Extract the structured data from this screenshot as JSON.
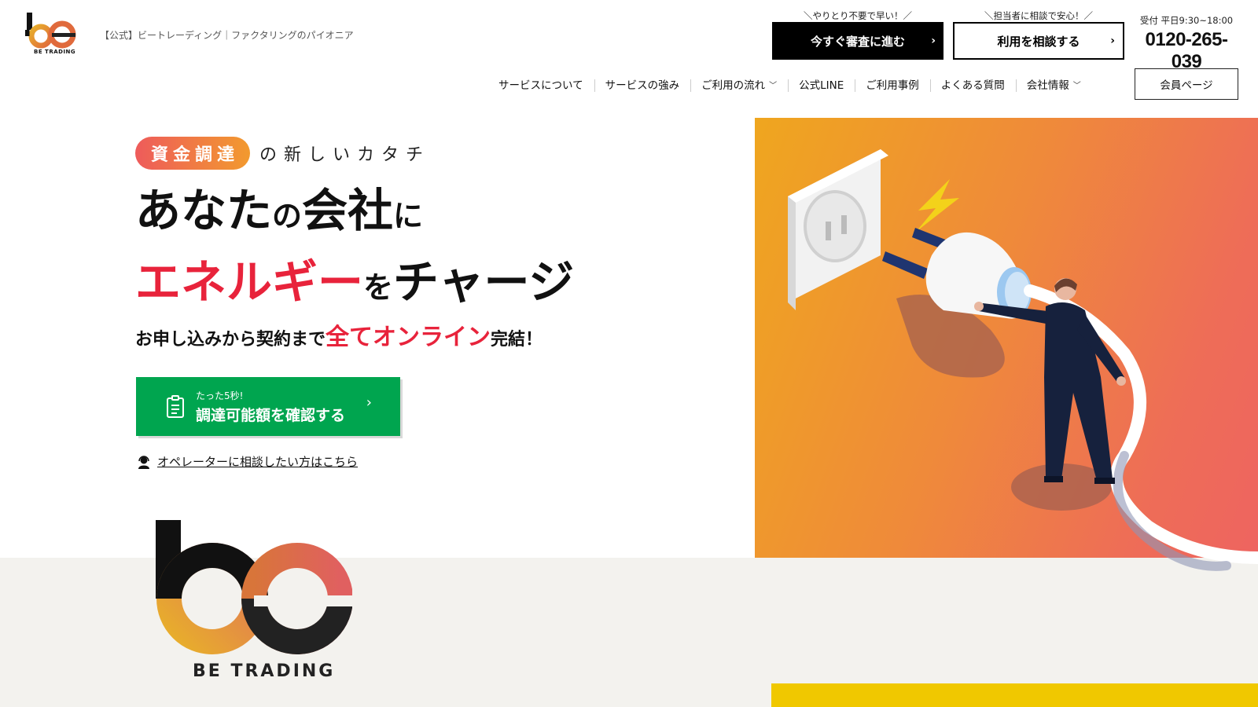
{
  "brand": {
    "logo_text": "BE TRADING",
    "tagline": "【公式】ビートレーディング｜ファクタリングのパイオニア"
  },
  "header": {
    "cta_primary": {
      "note": "＼やりとり不要で早い！／",
      "label": "今すぐ審査に進む"
    },
    "cta_secondary": {
      "note": "＼担当者に相談で安心！／",
      "label": "利用を相談する"
    },
    "phone": {
      "hours": "受付 平日9:30~18:00",
      "number": "0120-265-039"
    }
  },
  "nav": {
    "items": [
      {
        "label": "サービスについて"
      },
      {
        "label": "サービスの強み"
      },
      {
        "label": "ご利用の流れ"
      },
      {
        "label": "公式LINE"
      },
      {
        "label": "ご利用事例"
      },
      {
        "label": "よくある質問"
      },
      {
        "label": "会社情報"
      }
    ],
    "member_label": "会員ページ"
  },
  "hero": {
    "pill": "資金調達",
    "pill_after": "の新しいカタチ",
    "line1_a": "あなた",
    "line1_b": "の",
    "line1_c": "会社",
    "line1_d": "に",
    "line2_a": "エネルギー",
    "line2_b": "を",
    "line2_c": "チャージ",
    "sub_a": "お申し込みから契約まで",
    "sub_red": "全てオンライン",
    "sub_b": "完結！",
    "green_small": "たった5秒!",
    "green_big": "調達可能額を確認する",
    "operator_label": "オペレーターに相談したい方はこちら"
  },
  "colors": {
    "accent_red": "#e8233b",
    "green": "#00a54f",
    "gradient_start": "#efa61f",
    "gradient_end": "#ee6460",
    "yellow": "#f0c800"
  }
}
